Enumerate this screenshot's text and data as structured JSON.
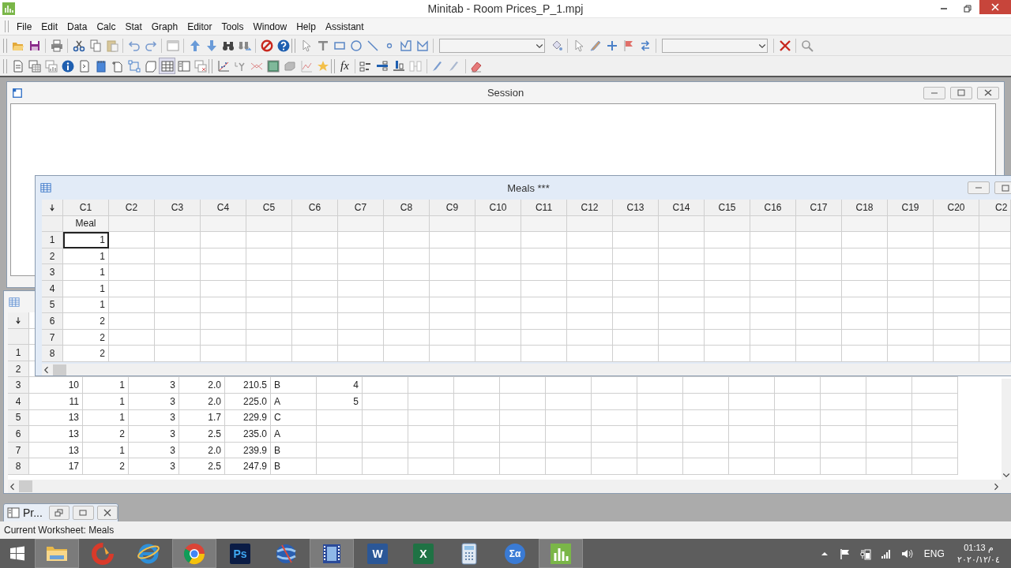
{
  "window": {
    "title": "Minitab - Room Prices_P_1.mpj"
  },
  "menu": [
    "File",
    "Edit",
    "Data",
    "Calc",
    "Stat",
    "Graph",
    "Editor",
    "Tools",
    "Window",
    "Help",
    "Assistant"
  ],
  "toolbar": {
    "formula_label": "fx"
  },
  "session": {
    "title": "Session",
    "active": false
  },
  "back_worksheet": {
    "active": false,
    "columns": [
      {
        "kind": "numeric"
      },
      {
        "kind": "numeric"
      },
      {
        "kind": "numeric"
      },
      {
        "kind": "numeric"
      },
      {
        "kind": "numeric"
      },
      {
        "kind": "text"
      },
      {
        "kind": "numeric"
      }
    ],
    "rows": [
      {
        "label": "1"
      },
      {
        "label": "2"
      },
      {
        "label": "3",
        "cells": [
          "10",
          "1",
          "3",
          "2.0",
          "210.5",
          "B",
          "4"
        ]
      },
      {
        "label": "4",
        "cells": [
          "11",
          "1",
          "3",
          "2.0",
          "225.0",
          "A",
          "5"
        ]
      },
      {
        "label": "5",
        "cells": [
          "13",
          "1",
          "3",
          "1.7",
          "229.9",
          "C"
        ]
      },
      {
        "label": "6",
        "cells": [
          "13",
          "2",
          "3",
          "2.5",
          "235.0",
          "A"
        ]
      },
      {
        "label": "7",
        "cells": [
          "13",
          "1",
          "3",
          "2.0",
          "239.9",
          "B"
        ]
      },
      {
        "label": "8",
        "cells": [
          "17",
          "2",
          "3",
          "2.5",
          "247.9",
          "B"
        ]
      }
    ]
  },
  "meals_worksheet": {
    "title": "Meals ***",
    "active": true,
    "columns": [
      "C1",
      "C2",
      "C3",
      "C4",
      "C5",
      "C6",
      "C7",
      "C8",
      "C9",
      "C10",
      "C11",
      "C12",
      "C13",
      "C14",
      "C15",
      "C16",
      "C17",
      "C18",
      "C19",
      "C20",
      "C2"
    ],
    "column_names": [
      "Meal"
    ],
    "rows": [
      {
        "label": "1",
        "cells": [
          "1"
        ],
        "current": true
      },
      {
        "label": "2",
        "cells": [
          "1"
        ],
        "current": false
      },
      {
        "label": "3",
        "cells": [
          "1"
        ],
        "current": false
      },
      {
        "label": "4",
        "cells": [
          "1"
        ],
        "current": false
      },
      {
        "label": "5",
        "cells": [
          "1"
        ],
        "current": false
      },
      {
        "label": "6",
        "cells": [
          "2"
        ],
        "current": false
      },
      {
        "label": "7",
        "cells": [
          "2"
        ],
        "current": false
      },
      {
        "label": "8",
        "cells": [
          "2"
        ],
        "current": false
      }
    ]
  },
  "minimized_window": {
    "title": "Pr..."
  },
  "status_bar": "Current Worksheet: Meals",
  "taskbar": {
    "apps": [
      {
        "kind": "explorer",
        "active": true
      },
      {
        "kind": "cleaner",
        "active": false
      },
      {
        "kind": "ie",
        "active": false
      },
      {
        "kind": "chrome",
        "active": true
      },
      {
        "kind": "photoshop",
        "label": "Ps",
        "active": false
      },
      {
        "kind": "globe",
        "active": false
      },
      {
        "kind": "video",
        "active": true
      },
      {
        "kind": "word",
        "label": "W",
        "active": false
      },
      {
        "kind": "excel",
        "label": "X",
        "active": false
      },
      {
        "kind": "calculator",
        "active": false
      },
      {
        "kind": "math",
        "label": "Σα",
        "active": false
      },
      {
        "kind": "minitab",
        "active": true
      }
    ],
    "language": "ENG",
    "time": "01:13 م",
    "date": "٢٠٢٠/١٢/٠٤"
  }
}
